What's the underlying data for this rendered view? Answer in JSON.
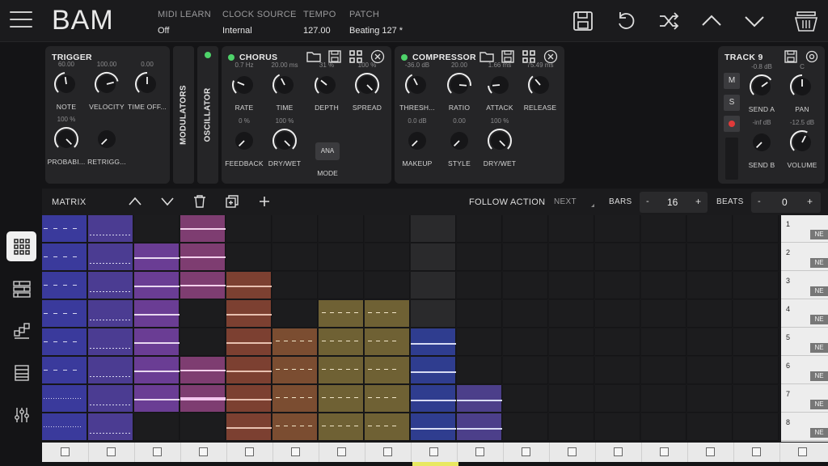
{
  "app": {
    "logo": "BAM"
  },
  "header": {
    "midi_learn": {
      "label": "MIDI LEARN",
      "value": "Off"
    },
    "clock_source": {
      "label": "CLOCK SOURCE",
      "value": "Internal"
    },
    "tempo": {
      "label": "TEMPO",
      "value": "127.00"
    },
    "patch": {
      "label": "PATCH",
      "value": "Beating 127 *"
    }
  },
  "trigger": {
    "title": "TRIGGER",
    "knobs": [
      {
        "label": "NOTE",
        "value": "60.00",
        "level": 0.47
      },
      {
        "label": "VELOCITY",
        "value": "100.00",
        "level": 0.78
      },
      {
        "label": "TIME OFF...",
        "value": "0.00",
        "level": 0.5
      },
      {
        "label": "PROBABI...",
        "value": "100 %",
        "level": 1.0
      },
      {
        "label": "RETRIGG...",
        "value": "",
        "level": 0.0
      }
    ]
  },
  "tabs": {
    "modulators": "MODULATORS",
    "oscillator": "OSCILLATOR"
  },
  "chorus": {
    "title": "CHORUS",
    "knobs": [
      {
        "label": "RATE",
        "value": "0.7 Hz",
        "level": 0.25
      },
      {
        "label": "TIME",
        "value": "20.00 ms",
        "level": 0.4
      },
      {
        "label": "DEPTH",
        "value": "31 %",
        "level": 0.31
      },
      {
        "label": "SPREAD",
        "value": "100 %",
        "level": 1.0
      },
      {
        "label": "FEEDBACK",
        "value": "0 %",
        "level": 0.0
      },
      {
        "label": "DRY/WET",
        "value": "100 %",
        "level": 1.0
      }
    ],
    "mode": {
      "label": "MODE",
      "value": "ANA"
    }
  },
  "compressor": {
    "title": "COMPRESSOR",
    "knobs": [
      {
        "label": "THRESH...",
        "value": "-36.0 dB",
        "level": 0.4
      },
      {
        "label": "RATIO",
        "value": "20.00",
        "level": 0.85
      },
      {
        "label": "ATTACK",
        "value": "1.66 ms",
        "level": 0.15
      },
      {
        "label": "RELEASE",
        "value": "75.49 ms",
        "level": 0.35
      },
      {
        "label": "MAKEUP",
        "value": "0.0 dB",
        "level": 0.0
      },
      {
        "label": "STYLE",
        "value": "0.00",
        "level": 0.0
      },
      {
        "label": "DRY/WET",
        "value": "100 %",
        "level": 1.0
      }
    ]
  },
  "track": {
    "title": "TRACK 9",
    "buttons": {
      "mute": "M",
      "solo": "S"
    },
    "knobs": [
      {
        "label": "SEND A",
        "value": "-0.8 dB",
        "level": 0.7
      },
      {
        "label": "PAN",
        "value": "C",
        "level": 0.5
      },
      {
        "label": "SEND B",
        "value": "-inf dB",
        "level": 0.0
      },
      {
        "label": "VOLUME",
        "value": "-12.5 dB",
        "level": 0.6
      }
    ]
  },
  "matrix": {
    "title": "MATRIX",
    "follow_action": "FOLLOW ACTION",
    "next": "NEXT",
    "bars_label": "BARS",
    "bars_value": "16",
    "beats_label": "BEATS",
    "beats_value": "0",
    "minus": "-",
    "plus": "+"
  },
  "tracks": [
    {
      "num": "1",
      "tag": "NE"
    },
    {
      "num": "2",
      "tag": "NE"
    },
    {
      "num": "3",
      "tag": "NE"
    },
    {
      "num": "4",
      "tag": "NE"
    },
    {
      "num": "5",
      "tag": "NE"
    },
    {
      "num": "6",
      "tag": "NE"
    },
    {
      "num": "7",
      "tag": "NE"
    },
    {
      "num": "8",
      "tag": "NE"
    }
  ],
  "colors": {
    "blue": "#3a3a9c",
    "violet": "#4b3c92",
    "purple": "#6a3d94",
    "magenta": "#7e3d71",
    "rust": "#7c4031",
    "orange": "#7b4d31",
    "olive": "#6f6134",
    "navy": "#2f3d8f",
    "lavender": "#4c3f8a",
    "accent_green": "#4ed36a",
    "record_red": "#e03a3a"
  }
}
